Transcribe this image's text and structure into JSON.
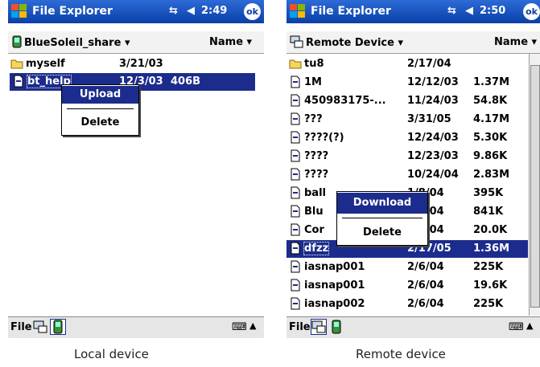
{
  "left_screen": {
    "title": "File Explorer",
    "time": "2:49",
    "ok_label": "ok",
    "location": "BlueSoleil_share",
    "sort_label": "Name",
    "files": [
      {
        "name": "myself",
        "date": "3/21/03",
        "size": "",
        "type": "folder",
        "selected": false
      },
      {
        "name": "bt_help",
        "date": "12/3/03",
        "size": "406B",
        "type": "file",
        "selected": true
      }
    ],
    "context_menu": {
      "items": [
        "Upload",
        "Delete"
      ],
      "highlighted": "Upload"
    },
    "bottom_menu": "File",
    "caption": "Local device"
  },
  "right_screen": {
    "title": "File Explorer",
    "time": "2:50",
    "ok_label": "ok",
    "location": "Remote Device",
    "sort_label": "Name",
    "files": [
      {
        "name": "tu8",
        "date": "2/17/04",
        "size": "",
        "type": "folder",
        "selected": false
      },
      {
        "name": "1M",
        "date": "12/12/03",
        "size": "1.37M",
        "type": "file",
        "selected": false
      },
      {
        "name": "450983175-...",
        "date": "11/24/03",
        "size": "54.8K",
        "type": "file",
        "selected": false
      },
      {
        "name": "???",
        "date": "3/31/05",
        "size": "4.17M",
        "type": "file",
        "selected": false
      },
      {
        "name": "????(?)",
        "date": "12/24/03",
        "size": "5.30K",
        "type": "file",
        "selected": false
      },
      {
        "name": "????",
        "date": "12/23/03",
        "size": "9.86K",
        "type": "file",
        "selected": false
      },
      {
        "name": "????",
        "date": "10/24/04",
        "size": "2.83M",
        "type": "file",
        "selected": false
      },
      {
        "name": "ball",
        "date": "1/8/04",
        "size": "395K",
        "type": "file",
        "selected": false
      },
      {
        "name": "Blu",
        "date": "/19/04",
        "size": "841K",
        "type": "file",
        "selected": false
      },
      {
        "name": "Cor",
        "date": "/12/04",
        "size": "20.0K",
        "type": "file",
        "selected": false
      },
      {
        "name": "dfzz",
        "date": "2/17/05",
        "size": "1.36M",
        "type": "file",
        "selected": true
      },
      {
        "name": "iasnap001",
        "date": "2/6/04",
        "size": "225K",
        "type": "file",
        "selected": false
      },
      {
        "name": "iasnap001",
        "date": "2/6/04",
        "size": "19.6K",
        "type": "file",
        "selected": false
      },
      {
        "name": "iasnap002",
        "date": "2/6/04",
        "size": "225K",
        "type": "file",
        "selected": false
      }
    ],
    "context_menu": {
      "items": [
        "Download",
        "Delete"
      ],
      "highlighted": "Download"
    },
    "bottom_menu": "File",
    "caption": "Remote device"
  },
  "colors": {
    "titlebar": "#0a3fa8",
    "selection": "#1c2c8c",
    "menubar": "#e6e6e6"
  },
  "icons": [
    "windows-flag-icon",
    "connectivity-icon",
    "volume-icon",
    "ok-icon",
    "folder-icon",
    "document-icon",
    "bluetooth-device-icon",
    "network-icon",
    "keyboard-icon"
  ]
}
